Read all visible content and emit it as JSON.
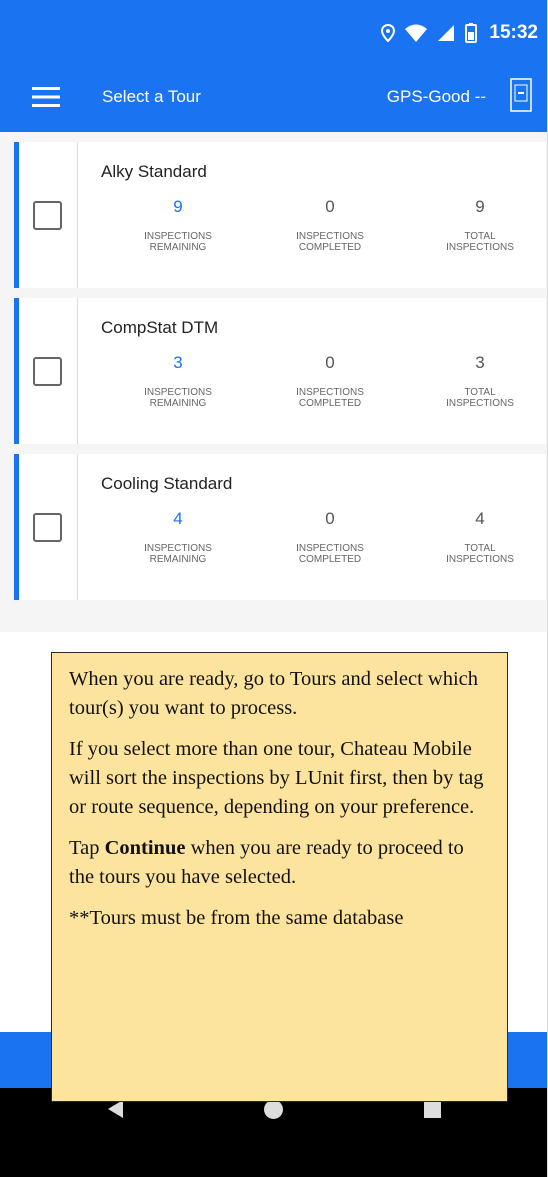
{
  "status_bar": {
    "time": "15:32",
    "icons": [
      "location-icon",
      "wifi-icon",
      "signal-icon",
      "battery-icon"
    ]
  },
  "app_bar": {
    "title": "Select a Tour",
    "gps_status": "GPS-Good  --",
    "icons": [
      "menu-icon",
      "gps-device-icon"
    ]
  },
  "tours": [
    {
      "name": "Alky Standard",
      "remaining": "9",
      "completed": "0",
      "total": "9"
    },
    {
      "name": "CompStat DTM",
      "remaining": "3",
      "completed": "0",
      "total": "3"
    },
    {
      "name": "Cooling Standard",
      "remaining": "4",
      "completed": "0",
      "total": "4"
    }
  ],
  "labels": {
    "remaining": "INSPECTIONS\nREMAINING",
    "completed": "INSPECTIONS\nCOMPLETED",
    "total": "TOTAL\nINSPECTIONS"
  },
  "tip": {
    "p1": "When you are ready, go to Tours and select which tour(s) you want to process.",
    "p2": "If you select more than one tour, Chateau Mobile will sort the inspections by LUnit first, then by tag or route sequence, depending on your preference.",
    "p3_before": "Tap ",
    "p3_bold": "Continue",
    "p3_after": " when you are ready to proceed to the tours you have selected.",
    "p4": "**Tours must be from the same database"
  },
  "colors": {
    "primary": "#1a73f1",
    "tip_background": "#fde49e",
    "navigation_bar": "#000000"
  },
  "navigation": {
    "icons": [
      "back-icon",
      "home-icon",
      "recents-icon"
    ]
  }
}
